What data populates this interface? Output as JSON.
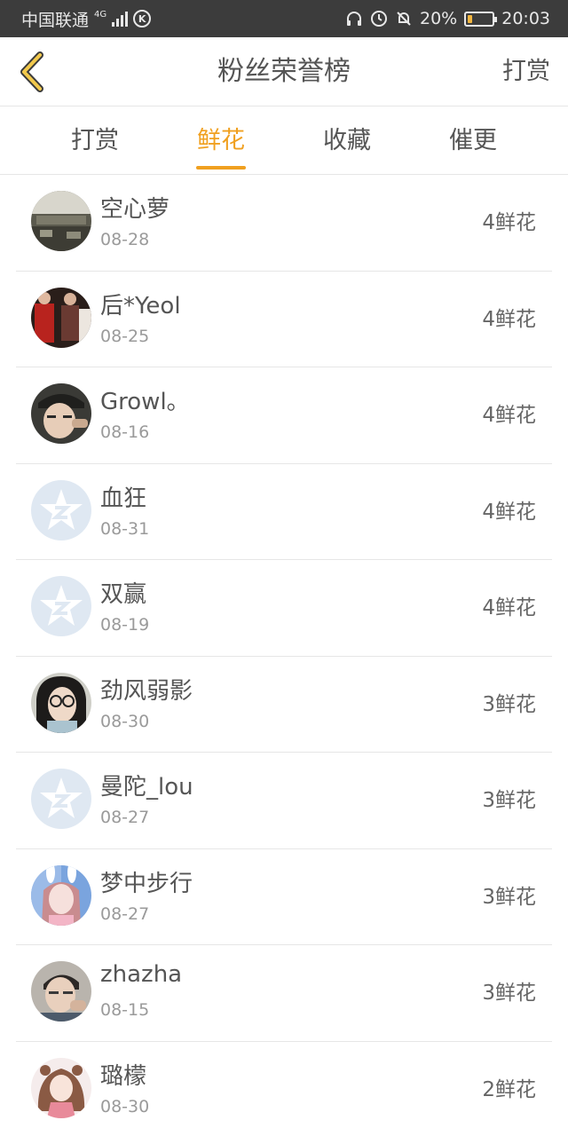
{
  "status_bar": {
    "carrier": "中国联通",
    "network": "4G",
    "battery_text": "20%",
    "battery_level": 0.2,
    "time": "20:03"
  },
  "header": {
    "title": "粉丝荣誉榜",
    "action_label": "打赏"
  },
  "tabs": [
    {
      "label": "打赏",
      "active": false
    },
    {
      "label": "鲜花",
      "active": true
    },
    {
      "label": "收藏",
      "active": false
    },
    {
      "label": "催更",
      "active": false
    }
  ],
  "colors": {
    "accent": "#f0a020",
    "divider": "#e6e6e6",
    "status_bar": "#3c3c3c"
  },
  "fans": [
    {
      "name": "空心萝",
      "date": "08-28",
      "count": "4鲜花",
      "avatar": "office-photo-avatar"
    },
    {
      "name": "后*Yeol",
      "date": "08-25",
      "count": "4鲜花",
      "avatar": "red-outfit-photo-avatar"
    },
    {
      "name": "Growl。",
      "date": "08-16",
      "count": "4鲜花",
      "avatar": "cap-person-avatar"
    },
    {
      "name": "血狂",
      "date": "08-31",
      "count": "4鲜花",
      "avatar": "default-star-avatar"
    },
    {
      "name": "双赢",
      "date": "08-19",
      "count": "4鲜花",
      "avatar": "default-star-avatar"
    },
    {
      "name": "劲风弱影",
      "date": "08-30",
      "count": "3鲜花",
      "avatar": "glasses-girl-avatar"
    },
    {
      "name": "曼陀_lou",
      "date": "08-27",
      "count": "3鲜花",
      "avatar": "default-star-avatar"
    },
    {
      "name": "梦中步行",
      "date": "08-27",
      "count": "3鲜花",
      "avatar": "bunny-girl-avatar"
    },
    {
      "name": "zhazha",
      "date": "08-15",
      "count": "3鲜花",
      "avatar": "boy-photo-avatar"
    },
    {
      "name": "璐檬",
      "date": "08-30",
      "count": "2鲜花",
      "avatar": "anime-girl-avatar"
    }
  ]
}
